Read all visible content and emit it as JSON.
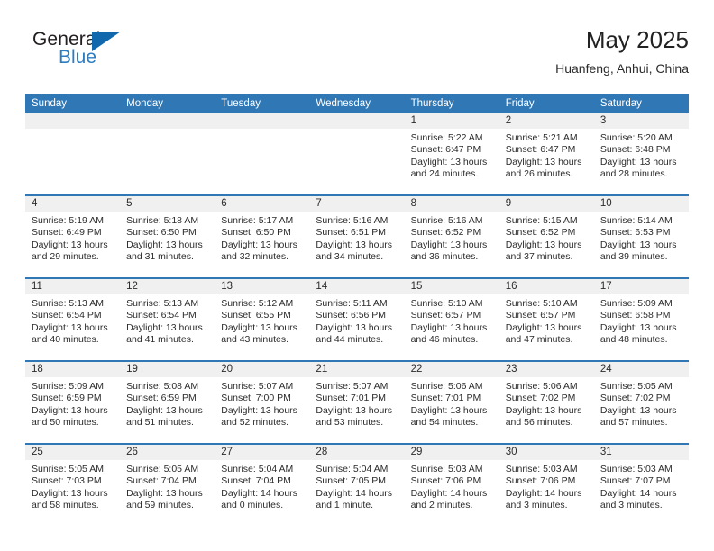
{
  "logo": {
    "word_one": "General",
    "word_two": "Blue",
    "triangle_color": "#1268ad",
    "blue_text_color": "#2e7cc0"
  },
  "header": {
    "title": "May 2025",
    "location": "Huanfeng, Anhui, China"
  },
  "theme": {
    "header_blue": "#3077b5",
    "date_band": "#f0f0f0",
    "text": "#2b2b2b"
  },
  "weekdays": [
    "Sunday",
    "Monday",
    "Tuesday",
    "Wednesday",
    "Thursday",
    "Friday",
    "Saturday"
  ],
  "weeks": [
    [
      {
        "day": "",
        "lines": []
      },
      {
        "day": "",
        "lines": []
      },
      {
        "day": "",
        "lines": []
      },
      {
        "day": "",
        "lines": []
      },
      {
        "day": "1",
        "lines": [
          "Sunrise: 5:22 AM",
          "Sunset: 6:47 PM",
          "Daylight: 13 hours",
          "and 24 minutes."
        ]
      },
      {
        "day": "2",
        "lines": [
          "Sunrise: 5:21 AM",
          "Sunset: 6:47 PM",
          "Daylight: 13 hours",
          "and 26 minutes."
        ]
      },
      {
        "day": "3",
        "lines": [
          "Sunrise: 5:20 AM",
          "Sunset: 6:48 PM",
          "Daylight: 13 hours",
          "and 28 minutes."
        ]
      }
    ],
    [
      {
        "day": "4",
        "lines": [
          "Sunrise: 5:19 AM",
          "Sunset: 6:49 PM",
          "Daylight: 13 hours",
          "and 29 minutes."
        ]
      },
      {
        "day": "5",
        "lines": [
          "Sunrise: 5:18 AM",
          "Sunset: 6:50 PM",
          "Daylight: 13 hours",
          "and 31 minutes."
        ]
      },
      {
        "day": "6",
        "lines": [
          "Sunrise: 5:17 AM",
          "Sunset: 6:50 PM",
          "Daylight: 13 hours",
          "and 32 minutes."
        ]
      },
      {
        "day": "7",
        "lines": [
          "Sunrise: 5:16 AM",
          "Sunset: 6:51 PM",
          "Daylight: 13 hours",
          "and 34 minutes."
        ]
      },
      {
        "day": "8",
        "lines": [
          "Sunrise: 5:16 AM",
          "Sunset: 6:52 PM",
          "Daylight: 13 hours",
          "and 36 minutes."
        ]
      },
      {
        "day": "9",
        "lines": [
          "Sunrise: 5:15 AM",
          "Sunset: 6:52 PM",
          "Daylight: 13 hours",
          "and 37 minutes."
        ]
      },
      {
        "day": "10",
        "lines": [
          "Sunrise: 5:14 AM",
          "Sunset: 6:53 PM",
          "Daylight: 13 hours",
          "and 39 minutes."
        ]
      }
    ],
    [
      {
        "day": "11",
        "lines": [
          "Sunrise: 5:13 AM",
          "Sunset: 6:54 PM",
          "Daylight: 13 hours",
          "and 40 minutes."
        ]
      },
      {
        "day": "12",
        "lines": [
          "Sunrise: 5:13 AM",
          "Sunset: 6:54 PM",
          "Daylight: 13 hours",
          "and 41 minutes."
        ]
      },
      {
        "day": "13",
        "lines": [
          "Sunrise: 5:12 AM",
          "Sunset: 6:55 PM",
          "Daylight: 13 hours",
          "and 43 minutes."
        ]
      },
      {
        "day": "14",
        "lines": [
          "Sunrise: 5:11 AM",
          "Sunset: 6:56 PM",
          "Daylight: 13 hours",
          "and 44 minutes."
        ]
      },
      {
        "day": "15",
        "lines": [
          "Sunrise: 5:10 AM",
          "Sunset: 6:57 PM",
          "Daylight: 13 hours",
          "and 46 minutes."
        ]
      },
      {
        "day": "16",
        "lines": [
          "Sunrise: 5:10 AM",
          "Sunset: 6:57 PM",
          "Daylight: 13 hours",
          "and 47 minutes."
        ]
      },
      {
        "day": "17",
        "lines": [
          "Sunrise: 5:09 AM",
          "Sunset: 6:58 PM",
          "Daylight: 13 hours",
          "and 48 minutes."
        ]
      }
    ],
    [
      {
        "day": "18",
        "lines": [
          "Sunrise: 5:09 AM",
          "Sunset: 6:59 PM",
          "Daylight: 13 hours",
          "and 50 minutes."
        ]
      },
      {
        "day": "19",
        "lines": [
          "Sunrise: 5:08 AM",
          "Sunset: 6:59 PM",
          "Daylight: 13 hours",
          "and 51 minutes."
        ]
      },
      {
        "day": "20",
        "lines": [
          "Sunrise: 5:07 AM",
          "Sunset: 7:00 PM",
          "Daylight: 13 hours",
          "and 52 minutes."
        ]
      },
      {
        "day": "21",
        "lines": [
          "Sunrise: 5:07 AM",
          "Sunset: 7:01 PM",
          "Daylight: 13 hours",
          "and 53 minutes."
        ]
      },
      {
        "day": "22",
        "lines": [
          "Sunrise: 5:06 AM",
          "Sunset: 7:01 PM",
          "Daylight: 13 hours",
          "and 54 minutes."
        ]
      },
      {
        "day": "23",
        "lines": [
          "Sunrise: 5:06 AM",
          "Sunset: 7:02 PM",
          "Daylight: 13 hours",
          "and 56 minutes."
        ]
      },
      {
        "day": "24",
        "lines": [
          "Sunrise: 5:05 AM",
          "Sunset: 7:02 PM",
          "Daylight: 13 hours",
          "and 57 minutes."
        ]
      }
    ],
    [
      {
        "day": "25",
        "lines": [
          "Sunrise: 5:05 AM",
          "Sunset: 7:03 PM",
          "Daylight: 13 hours",
          "and 58 minutes."
        ]
      },
      {
        "day": "26",
        "lines": [
          "Sunrise: 5:05 AM",
          "Sunset: 7:04 PM",
          "Daylight: 13 hours",
          "and 59 minutes."
        ]
      },
      {
        "day": "27",
        "lines": [
          "Sunrise: 5:04 AM",
          "Sunset: 7:04 PM",
          "Daylight: 14 hours",
          "and 0 minutes."
        ]
      },
      {
        "day": "28",
        "lines": [
          "Sunrise: 5:04 AM",
          "Sunset: 7:05 PM",
          "Daylight: 14 hours",
          "and 1 minute."
        ]
      },
      {
        "day": "29",
        "lines": [
          "Sunrise: 5:03 AM",
          "Sunset: 7:06 PM",
          "Daylight: 14 hours",
          "and 2 minutes."
        ]
      },
      {
        "day": "30",
        "lines": [
          "Sunrise: 5:03 AM",
          "Sunset: 7:06 PM",
          "Daylight: 14 hours",
          "and 3 minutes."
        ]
      },
      {
        "day": "31",
        "lines": [
          "Sunrise: 5:03 AM",
          "Sunset: 7:07 PM",
          "Daylight: 14 hours",
          "and 3 minutes."
        ]
      }
    ]
  ]
}
